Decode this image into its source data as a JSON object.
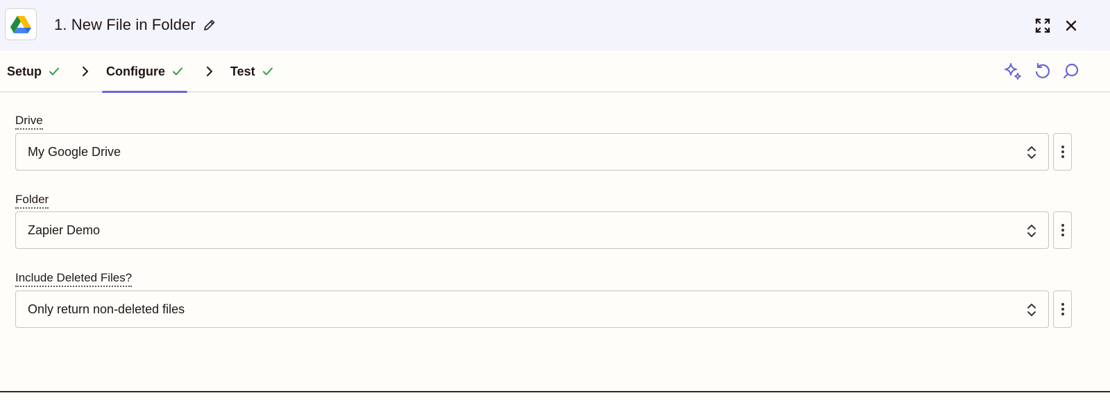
{
  "header": {
    "title": "1. New File in Folder",
    "app_icon": "google-drive-icon",
    "edit_icon": "pencil-icon",
    "expand_icon": "expand-icon",
    "close_icon": "close-icon"
  },
  "tabs": [
    {
      "label": "Setup",
      "status_icon": "check-icon"
    },
    {
      "label": "Configure",
      "status_icon": "check-icon"
    },
    {
      "label": "Test",
      "status_icon": "check-icon"
    }
  ],
  "active_tab": "Configure",
  "toolbar": {
    "icons": [
      "sparkle-icon",
      "undo-icon",
      "search-icon"
    ]
  },
  "fields": [
    {
      "label": "Drive",
      "value": "My Google Drive"
    },
    {
      "label": "Folder",
      "value": "Zapier Demo"
    },
    {
      "label": "Include Deleted Files?",
      "value": "Only return non-deleted files"
    }
  ],
  "colors": {
    "header_bg": "#f4f4fc",
    "page_bg": "#fffdf9",
    "accent": "#6866d6",
    "check_green": "#2f9e44",
    "text": "#201515"
  }
}
